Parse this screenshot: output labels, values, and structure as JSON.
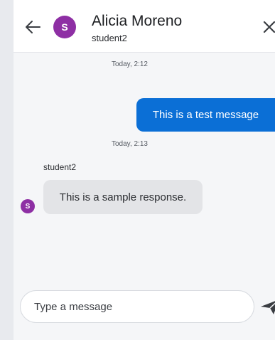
{
  "header": {
    "avatar_initial": "S",
    "contact_name": "Alicia Moreno",
    "contact_username": "student2"
  },
  "conversation": {
    "messages": [
      {
        "timestamp": "Today, 2:12",
        "direction": "outgoing",
        "text": "This is a test message"
      },
      {
        "timestamp": "Today, 2:13",
        "direction": "incoming",
        "sender": "student2",
        "sender_initial": "S",
        "text": "This is a sample response."
      }
    ]
  },
  "composer": {
    "placeholder": "Type a message"
  },
  "colors": {
    "accent": "#0b6fd6",
    "avatar": "#8e2fa4",
    "incoming_bubble": "#e3e4e7"
  },
  "icons": [
    "back-arrow-icon",
    "close-icon",
    "send-icon"
  ]
}
